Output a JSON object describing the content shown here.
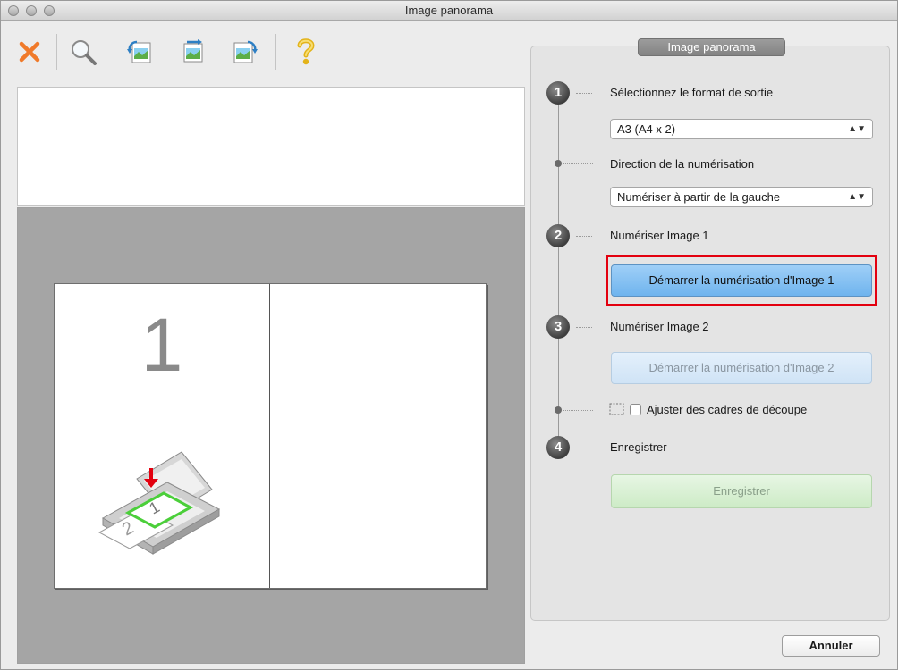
{
  "window": {
    "title": "Image panorama"
  },
  "toolbar": {
    "icons": [
      "delete-icon",
      "magnifier-icon",
      "rotate-left-icon",
      "flip-icon",
      "rotate-right-icon",
      "help-icon"
    ]
  },
  "preview": {
    "page_number": "1"
  },
  "panel": {
    "tab_label": "Image panorama",
    "step1": {
      "number": "1",
      "label": "Sélectionnez le format de sortie",
      "format_value": "A3 (A4 x 2)",
      "direction_label": "Direction de la numérisation",
      "direction_value": "Numériser à partir de la gauche"
    },
    "step2": {
      "number": "2",
      "label": "Numériser Image 1",
      "button": "Démarrer la numérisation d'Image 1"
    },
    "step3": {
      "number": "3",
      "label": "Numériser Image 2",
      "button": "Démarrer la numérisation d'Image 2",
      "checkbox_label": "Ajuster des cadres de découpe"
    },
    "step4": {
      "number": "4",
      "label": "Enregistrer",
      "button": "Enregistrer"
    }
  },
  "footer": {
    "cancel_label": "Annuler"
  },
  "colors": {
    "highlight": "#e3000f",
    "primary_button": "#6fb4ee",
    "save_button": "#cdebc6"
  }
}
